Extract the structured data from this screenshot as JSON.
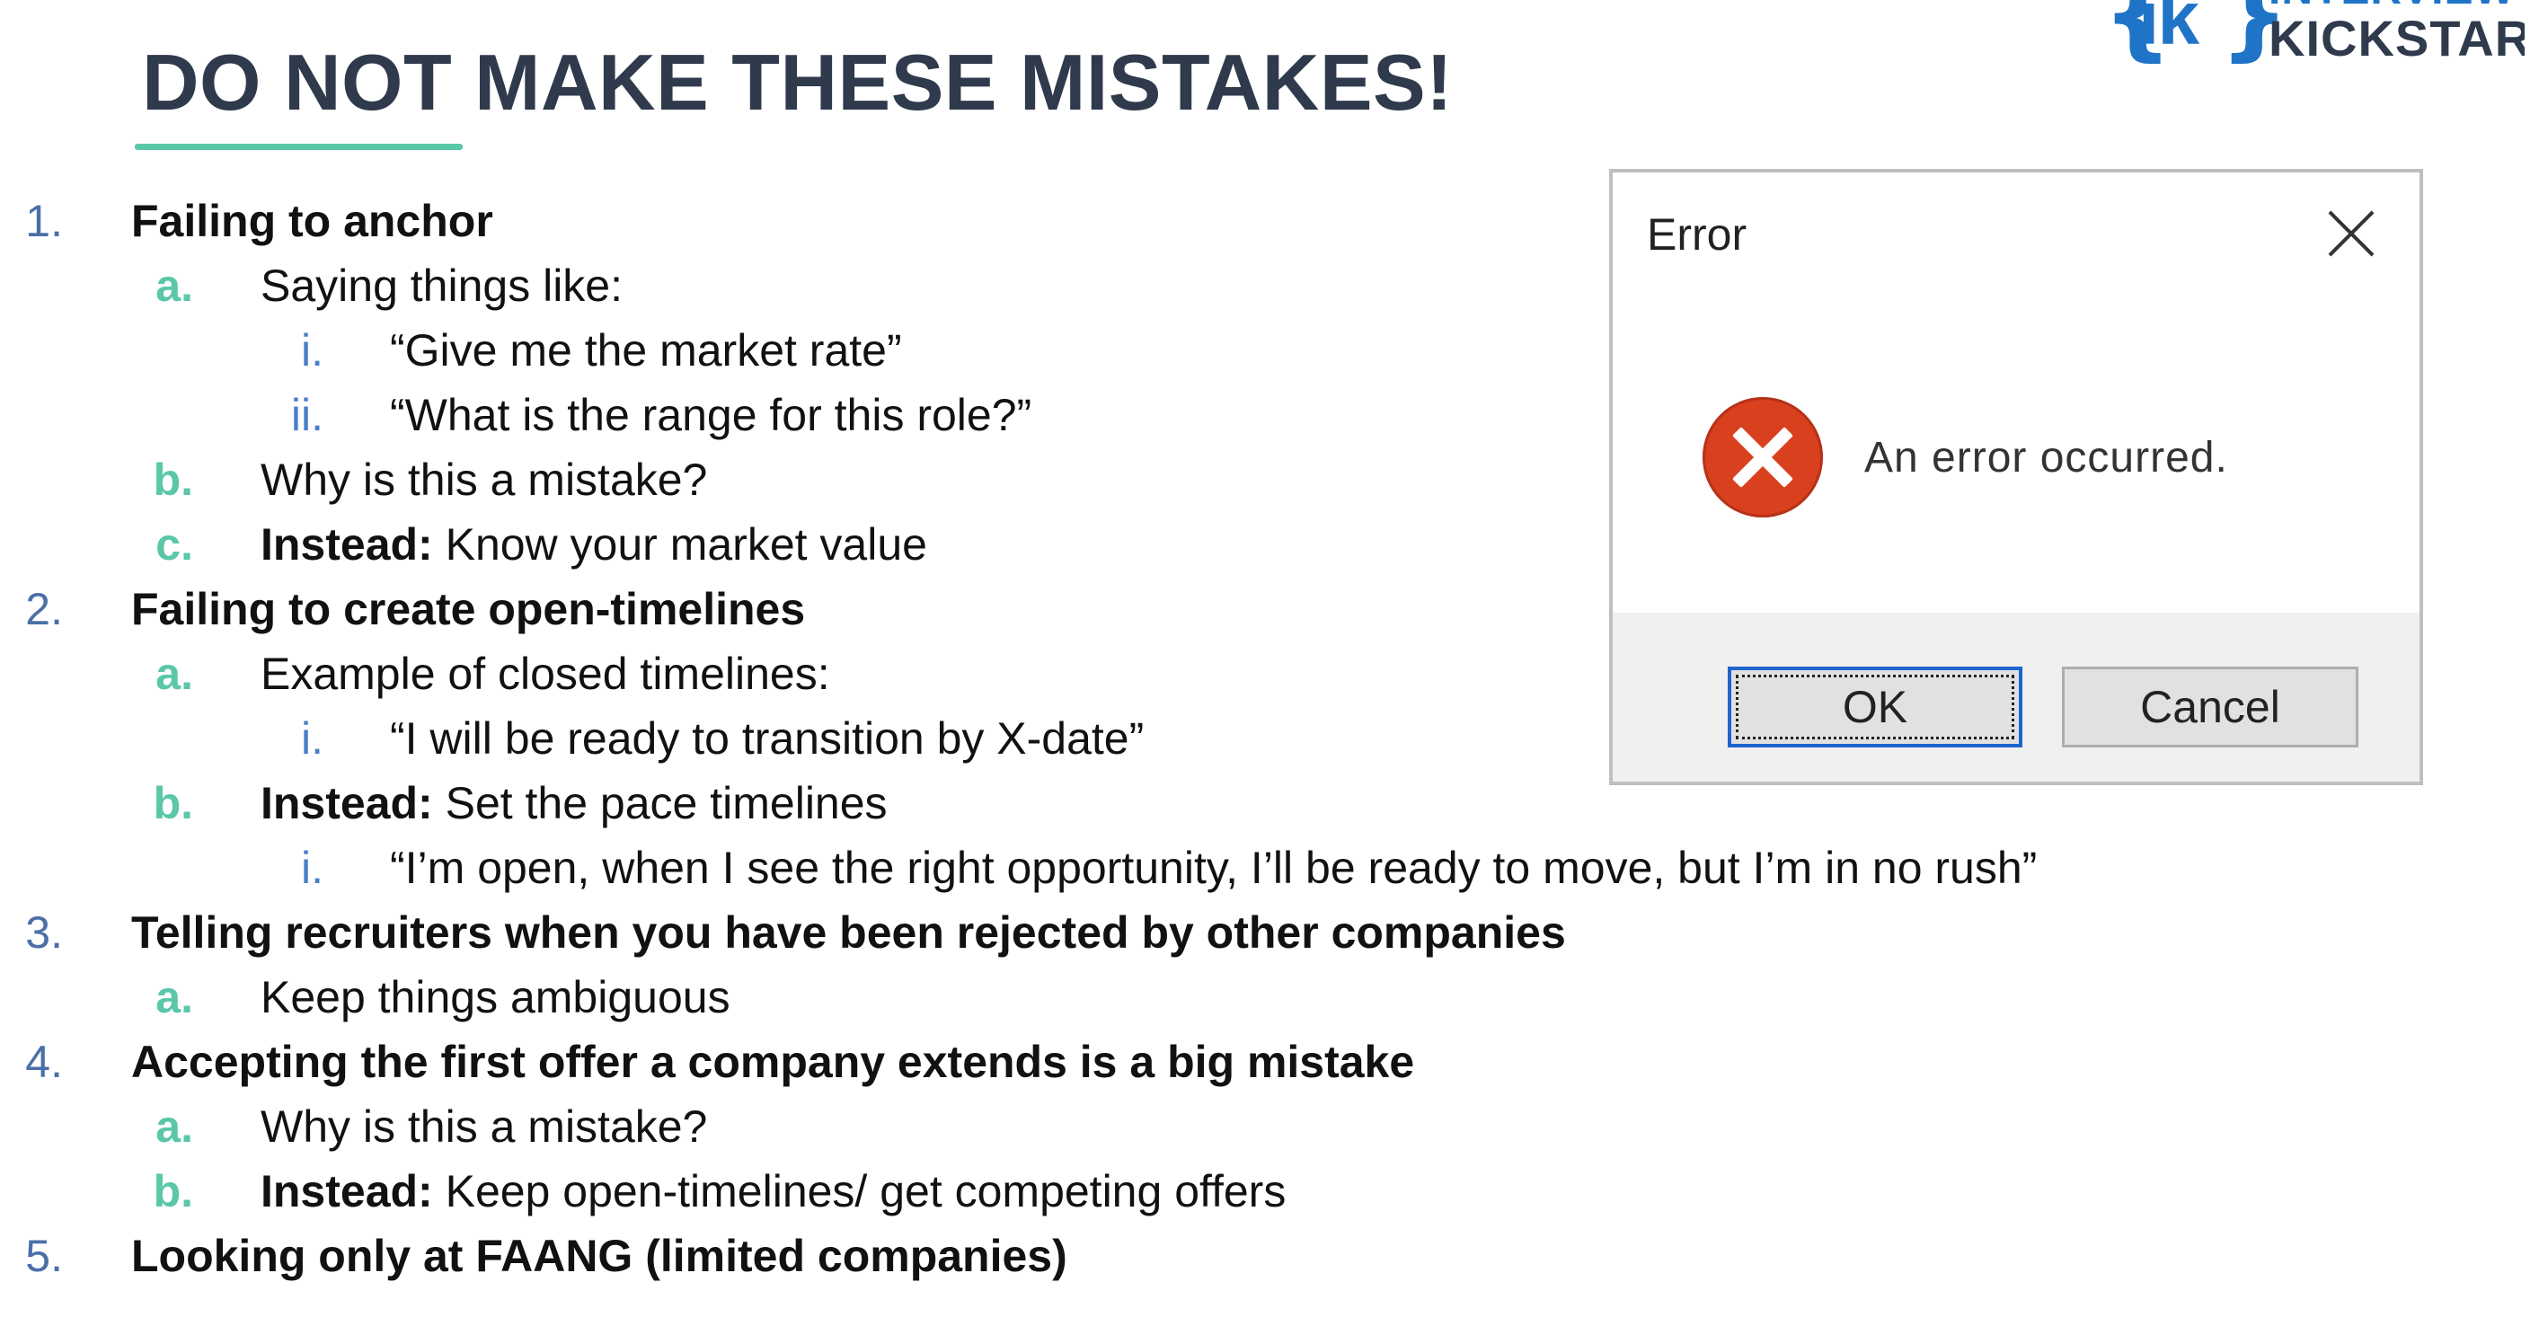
{
  "logo": {
    "brace_open": "{",
    "mark": "ik",
    "brace_close": "}",
    "line1": "INTERVIEW",
    "line2": "KICKSTART",
    "brand_color": "#1f74c8",
    "dark_color": "#2f3a4c"
  },
  "title": "DO NOT MAKE THESE MISTAKES!",
  "accent_color": "#5ac7a8",
  "outline": [
    {
      "marker": "1.",
      "text": "Failing to anchor"
    },
    {
      "marker": "a.",
      "text": "Saying things like:"
    },
    {
      "marker": "i.",
      "text": "“Give me the market rate”"
    },
    {
      "marker": "ii.",
      "text": "“What is the range for this role?”"
    },
    {
      "marker": "b.",
      "text": "Why is this a mistake?"
    },
    {
      "marker": "c.",
      "bold": "Instead:",
      "text": " Know your market value"
    },
    {
      "marker": "2.",
      "text": "Failing to create open-timelines"
    },
    {
      "marker": "a.",
      "text": "Example of closed timelines:"
    },
    {
      "marker": "i.",
      "text": "“I will be ready to transition by X-date”"
    },
    {
      "marker": "b.",
      "bold": "Instead:",
      "text": " Set the pace timelines"
    },
    {
      "marker": "i.",
      "text": "“I’m open, when I see the right opportunity, I’ll be ready to move, but I’m in no rush”"
    },
    {
      "marker": "3.",
      "text": "Telling recruiters when you have been rejected by other companies"
    },
    {
      "marker": "a.",
      "text": "Keep things ambiguous"
    },
    {
      "marker": "4.",
      "text": "Accepting the first offer a company extends is a big mistake"
    },
    {
      "marker": "a.",
      "text": "Why is this a mistake?"
    },
    {
      "marker": "b.",
      "bold": "Instead:",
      "text": " Keep open-timelines/ get competing offers"
    },
    {
      "marker": "5.",
      "text": "Looking only at FAANG (limited companies)"
    }
  ],
  "dialog": {
    "title": "Error",
    "message": "An error occurred.",
    "ok_label": "OK",
    "cancel_label": "Cancel",
    "icon": "error-icon",
    "close_icon": "close-icon",
    "icon_color": "#d9401e",
    "focus_color": "#1e64d0"
  }
}
